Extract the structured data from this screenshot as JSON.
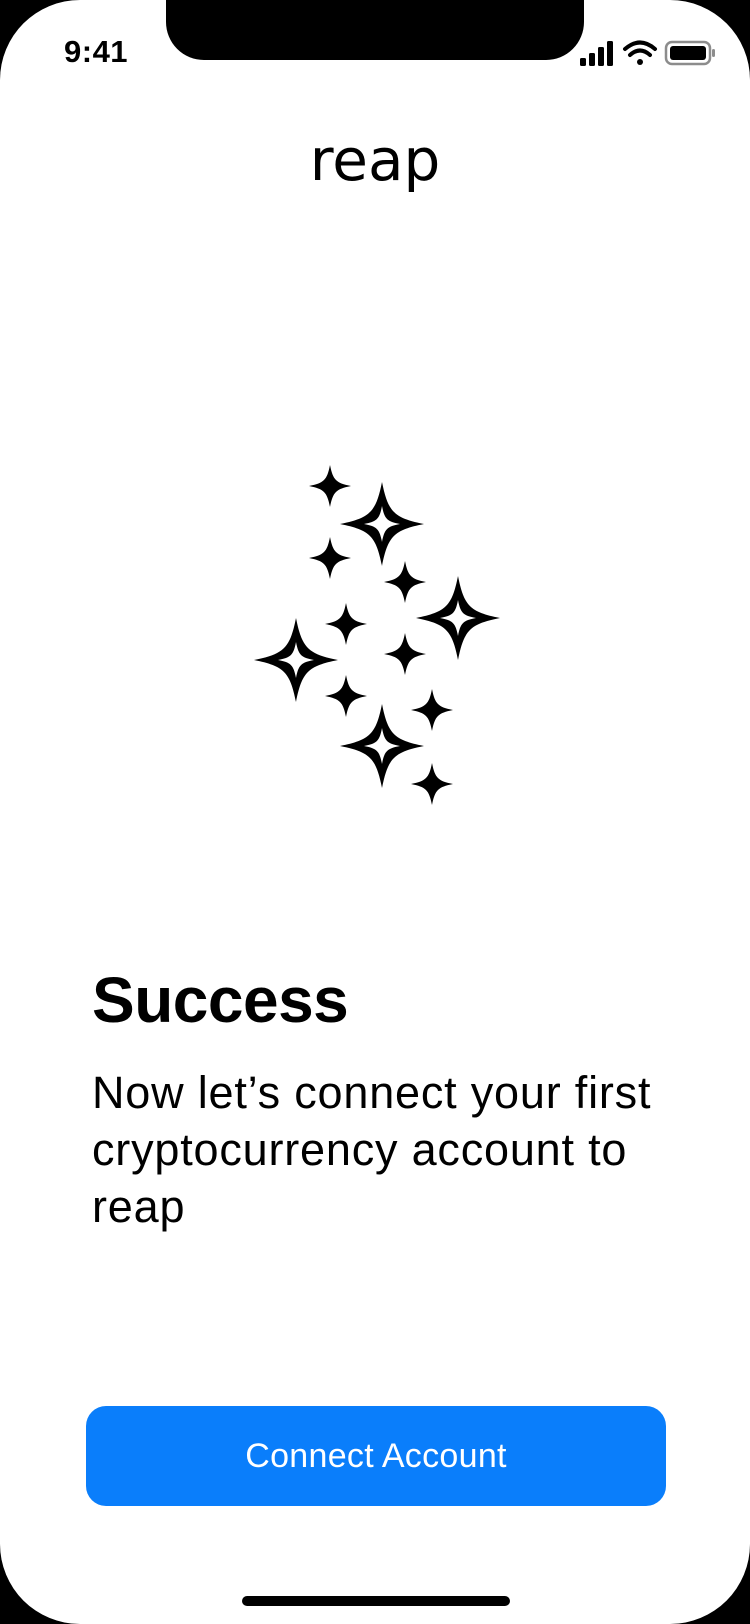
{
  "status_bar": {
    "time": "9:41",
    "icons": [
      "cellular-signal-icon",
      "wifi-icon",
      "battery-icon"
    ]
  },
  "brand": {
    "logo_text": "reap"
  },
  "illustration": {
    "icon": "sparkles-icon"
  },
  "content": {
    "title": "Success",
    "subtitle": "Now let’s connect your first cryptocurrency account to reap"
  },
  "actions": {
    "primary_label": "Connect Account"
  },
  "colors": {
    "accent": "#0a7efb",
    "background": "#ffffff",
    "text": "#000000"
  }
}
